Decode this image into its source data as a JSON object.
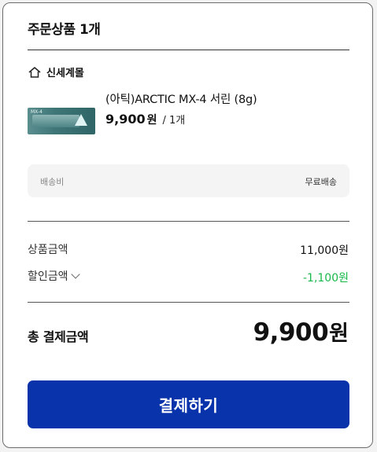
{
  "order": {
    "title": "주문상품 1개",
    "store_name": "신세계몰",
    "product": {
      "name": "(아틱)ARCTIC MX-4 서린 (8g)",
      "price": "9,900",
      "currency": "원",
      "quantity": "/ 1개",
      "thumbnail_text": "MX-4"
    },
    "shipping": {
      "label": "배송비",
      "value": "무료배송"
    }
  },
  "summary": {
    "subtotal_label": "상품금액",
    "subtotal_value": "11,000원",
    "discount_label": "할인금액",
    "discount_value": "-1,100원",
    "total_label": "총 결제금액",
    "total_value": "9,900",
    "total_currency": "원"
  },
  "actions": {
    "pay_label": "결제하기"
  },
  "colors": {
    "primary_button": "#0933aa",
    "discount_text": "#19b84a"
  }
}
